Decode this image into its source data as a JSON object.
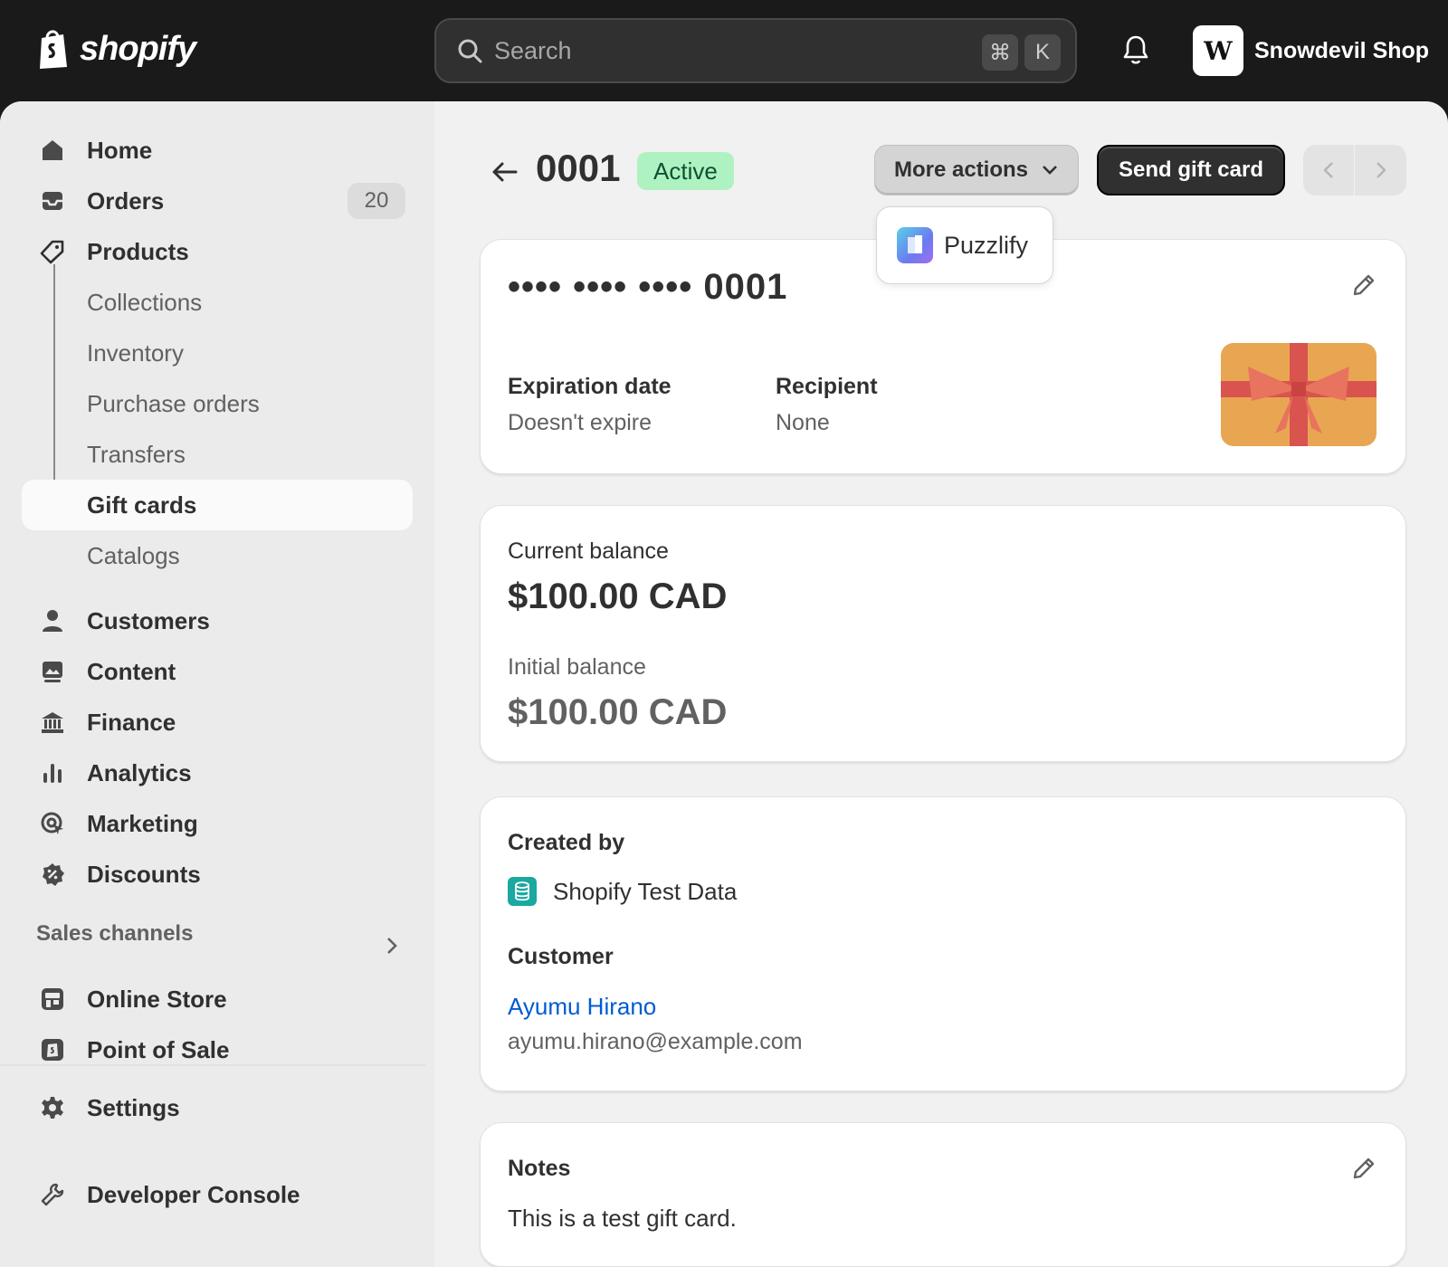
{
  "topbar": {
    "logo_text": "shopify",
    "search_placeholder": "Search",
    "shortcut_cmd": "⌘",
    "shortcut_key": "K",
    "store_initials": "W",
    "store_name": "Snowdevil Shop"
  },
  "sidebar": {
    "home": "Home",
    "orders": "Orders",
    "orders_count": "20",
    "products": "Products",
    "collections": "Collections",
    "inventory": "Inventory",
    "purchase_orders": "Purchase orders",
    "transfers": "Transfers",
    "gift_cards": "Gift cards",
    "catalogs": "Catalogs",
    "customers": "Customers",
    "content": "Content",
    "finance": "Finance",
    "analytics": "Analytics",
    "marketing": "Marketing",
    "discounts": "Discounts",
    "sales_channels": "Sales channels",
    "online_store": "Online Store",
    "point_of_sale": "Point of Sale",
    "settings": "Settings",
    "developer_console": "Developer Console"
  },
  "header": {
    "title": "0001",
    "status": "Active",
    "more_actions": "More actions",
    "send_gift_card": "Send gift card"
  },
  "dropdown": {
    "item": "Puzzlify"
  },
  "gift_card": {
    "masked_code": "•••• •••• •••• 0001",
    "expiration_label": "Expiration date",
    "expiration_value": "Doesn't expire",
    "recipient_label": "Recipient",
    "recipient_value": "None"
  },
  "balance": {
    "current_label": "Current balance",
    "current_value": "$100.00 CAD",
    "initial_label": "Initial balance",
    "initial_value": "$100.00 CAD"
  },
  "creator": {
    "created_by_label": "Created by",
    "created_by_value": "Shopify Test Data",
    "customer_label": "Customer",
    "customer_name": "Ayumu Hirano",
    "customer_email": "ayumu.hirano@example.com"
  },
  "notes": {
    "label": "Notes",
    "text": "This is a test gift card."
  },
  "colors": {
    "active_badge_bg": "#aff2c2",
    "link": "#005bd3",
    "primary_button": "#303030"
  }
}
